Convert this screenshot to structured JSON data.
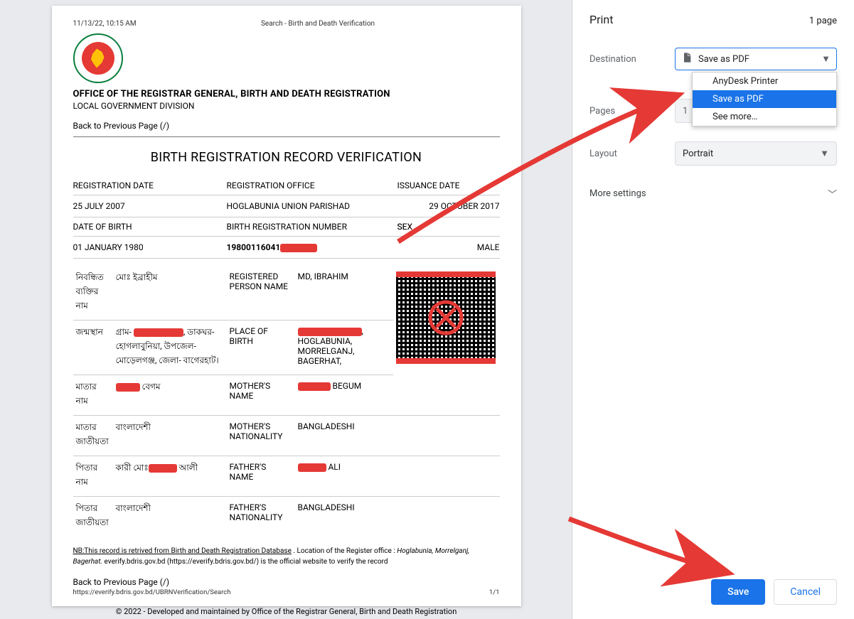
{
  "document": {
    "timestamp": "11/13/22, 10:15 AM",
    "header_center": "Search - Birth and Death Verification",
    "office_title": "OFFICE OF THE REGISTRAR GENERAL, BIRTH AND DEATH REGISTRATION",
    "office_sub": "LOCAL GOVERNMENT DIVISION",
    "back_link": "Back to Previous Page (/)",
    "main_title": "BIRTH REGISTRATION RECORD VERIFICATION",
    "headers": {
      "reg_date": "REGISTRATION DATE",
      "reg_office": "REGISTRATION OFFICE",
      "iss_date": "ISSUANCE DATE"
    },
    "values": {
      "reg_date": "25 JULY 2007",
      "reg_office": "HOGLABUNIA UNION PARISHAD",
      "iss_date": "29 OCTOBER 2017"
    },
    "headers2": {
      "dob": "DATE OF BIRTH",
      "brn": "BIRTH REGISTRATION NUMBER",
      "sex": "SEX"
    },
    "values2": {
      "dob": "01 JANUARY 1980",
      "brn_prefix": "19800116041",
      "sex": "MALE"
    },
    "rows": {
      "name": {
        "bn_label": "নিবন্ধিত ব্যক্তির নাম",
        "bn_value": "মোঃ ইব্রাহীম",
        "en_label": "REGISTERED PERSON NAME",
        "en_value": "MD, IBRAHIM"
      },
      "place": {
        "bn_label": "জন্মস্থান",
        "bn_value_prefix": "গ্রাম- ",
        "bn_value_suffix": ", ডাকঘর- হোগলাবুনিয়া, উপজেল- মোড়েলগঞ্জ, জেলা- বাগেরহাট।",
        "en_label": "PLACE OF BIRTH",
        "en_value_suffix": ", HOGLABUNIA, MORRELGANJ, BAGERHAT,"
      },
      "mother": {
        "bn_label": "মাতার নাম",
        "bn_value_suffix": " বেগম",
        "en_label": "MOTHER'S NAME",
        "en_value_suffix": " BEGUM"
      },
      "mother_nat": {
        "bn_label": "মাতার জাতীয়তা",
        "bn_value": "বাংলাদেশী",
        "en_label": "MOTHER'S NATIONALITY",
        "en_value": "BANGLADESHI"
      },
      "father": {
        "bn_label": "পিতার নাম",
        "bn_value_prefix": "কারী মোঃ",
        "bn_value_suffix": " আলী",
        "en_label": "FATHER'S NAME",
        "en_value_suffix": " ALI"
      },
      "father_nat": {
        "bn_label": "পিতার জাতীয়তা",
        "bn_value": "বাংলাদেশী",
        "en_label": "FATHER'S NATIONALITY",
        "en_value": "BANGLADESHI"
      }
    },
    "nb_underline": "NB:This record is retrived from Birth and Death Registration Database",
    "nb_rest": " . Location of the Register office : ",
    "nb_italic": "Hoglabunia, Morrelganj, Bagerhat.",
    "nb_line2": " everify.bdris.gov.bd (https://everify.bdris.gov.bd/) is the official website to verify the record",
    "footer_note": "© 2022 - Developed and maintained by Office of the Registrar General, Birth and Death Registration",
    "footer_url": "https://everify.bdris.gov.bd/UBRNVerification/Search",
    "footer_page": "1/1"
  },
  "print": {
    "title": "Print",
    "page_count": "1 page",
    "labels": {
      "destination": "Destination",
      "pages": "Pages",
      "layout": "Layout",
      "more": "More settings"
    },
    "destination_value": "Save as PDF",
    "destination_options": [
      "AnyDesk Printer",
      "Save as PDF",
      "See more…"
    ],
    "destination_selected_index": 1,
    "pages_value": "1",
    "layout_value": "Portrait",
    "save": "Save",
    "cancel": "Cancel"
  }
}
